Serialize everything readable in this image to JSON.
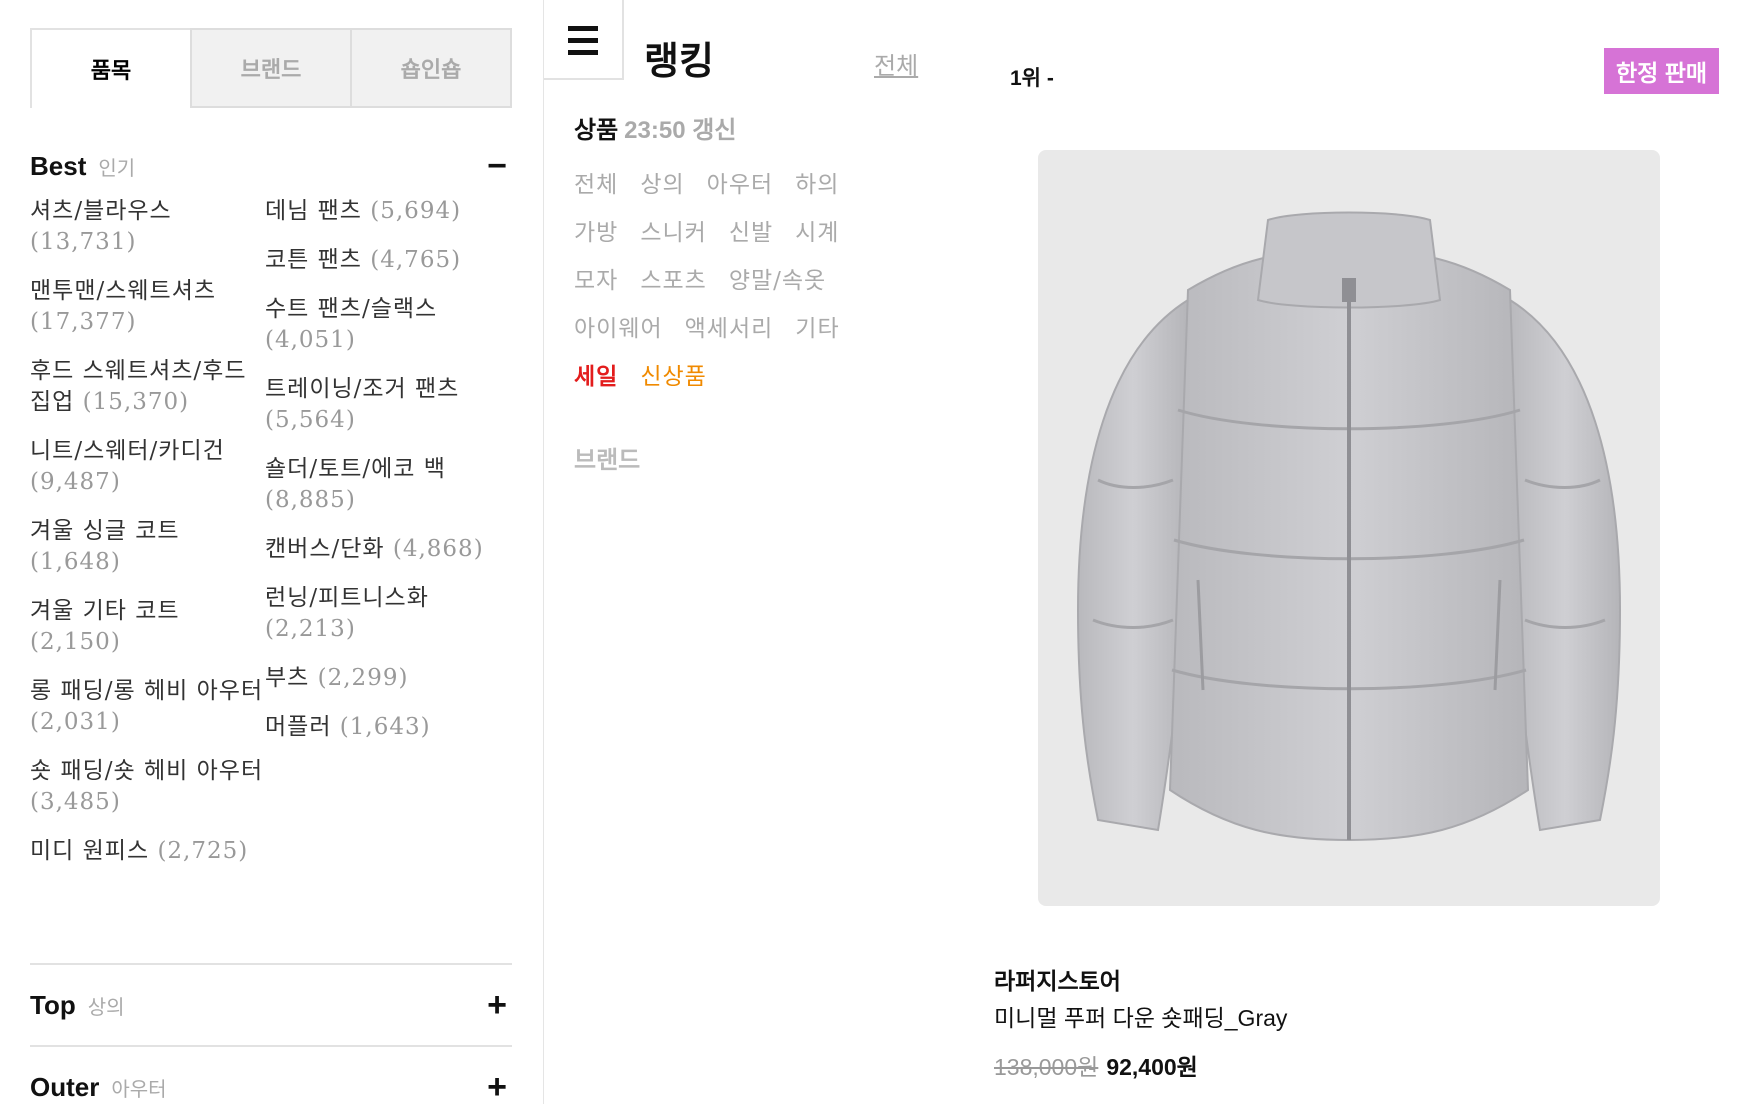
{
  "tabs": [
    "품목",
    "브랜드",
    "숍인숍"
  ],
  "best": {
    "title": "Best",
    "subtitle": "인기",
    "toggle": "−",
    "col1": [
      {
        "name": "셔츠/블라우스",
        "count": "(13,731)"
      },
      {
        "name": "맨투맨/스웨트셔츠",
        "count": "(17,377)"
      },
      {
        "name": "후드 스웨트셔츠/후드 집업",
        "count": "(15,370)"
      },
      {
        "name": "니트/스웨터/카디건",
        "count": "(9,487)"
      },
      {
        "name": "겨울 싱글 코트",
        "count": "(1,648)"
      },
      {
        "name": "겨울 기타 코트",
        "count": "(2,150)"
      },
      {
        "name": "롱 패딩/롱 헤비 아우터",
        "count": "(2,031)"
      },
      {
        "name": "숏 패딩/숏 헤비 아우터",
        "count": "(3,485)"
      },
      {
        "name": "미디 원피스",
        "count": "(2,725)"
      }
    ],
    "col2": [
      {
        "name": "데님 팬츠",
        "count": "(5,694)"
      },
      {
        "name": "코튼 팬츠",
        "count": "(4,765)"
      },
      {
        "name": "수트 팬츠/슬랙스",
        "count": "(4,051)"
      },
      {
        "name": "트레이닝/조거 팬츠",
        "count": "(5,564)"
      },
      {
        "name": "숄더/토트/에코 백",
        "count": "(8,885)"
      },
      {
        "name": "캔버스/단화",
        "count": "(4,868)"
      },
      {
        "name": "런닝/피트니스화",
        "count": "(2,213)"
      },
      {
        "name": "부츠",
        "count": "(2,299)"
      },
      {
        "name": "머플러",
        "count": "(1,643)"
      }
    ]
  },
  "top_section": {
    "title": "Top",
    "subtitle": "상의",
    "toggle": "+"
  },
  "outer_section": {
    "title": "Outer",
    "subtitle": "아우터",
    "toggle": "+"
  },
  "ranking": {
    "title": "랭킹",
    "all_link": "전체",
    "product_label": "상품",
    "updated": "23:50 갱신",
    "filters_row1": [
      "전체",
      "상의",
      "아우터",
      "하의"
    ],
    "filters_row2": [
      "가방",
      "스니커",
      "신발",
      "시계"
    ],
    "filters_row3": [
      "모자",
      "스포츠",
      "양말/속옷"
    ],
    "filters_row4": [
      "아이웨어",
      "액세서리",
      "기타"
    ],
    "sale": "세일",
    "new": "신상품",
    "brand": "브랜드"
  },
  "product": {
    "rank": "1위 -",
    "badge": "한정 판매",
    "brand": "라퍼지스토어",
    "name": "미니멀 푸퍼 다운 숏패딩_Gray",
    "original_price": "138,000원",
    "sale_price": "92,400원"
  },
  "colors": {
    "badge": "#d673d6",
    "sale": "#e31c1c",
    "new": "#f08a00"
  }
}
